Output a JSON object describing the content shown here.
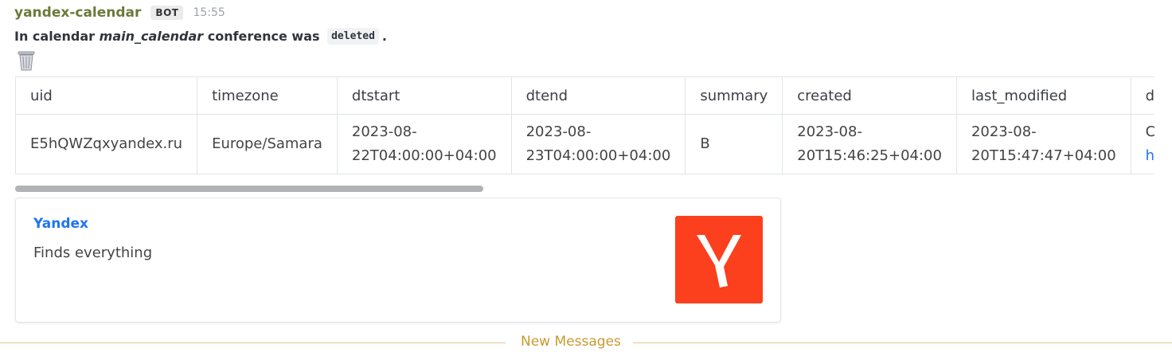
{
  "message": {
    "sender": "yandex-calendar",
    "badge": "BOT",
    "time": "15:55",
    "text_prefix": "In calendar ",
    "calendar_name": "main_calendar",
    "text_middle": " conference was ",
    "status_code": "deleted",
    "text_suffix": ".",
    "trash_icon": "wastebasket-icon"
  },
  "table": {
    "headers": [
      "uid",
      "timezone",
      "dtstart",
      "dtend",
      "summary",
      "created",
      "last_modified",
      "descrip"
    ],
    "row": {
      "uid": "E5hQWZqxyandex.ru",
      "timezone": "Europe/Samara",
      "dtstart_1": "2023-08-",
      "dtstart_2": "22T04:00:00+04:00",
      "dtend_1": "2023-08-",
      "dtend_2": "23T04:00:00+04:00",
      "summary": "B",
      "created_1": "2023-08-",
      "created_2": "20T15:46:25+04:00",
      "last_modified_1": "2023-08-",
      "last_modified_2": "20T15:47:47+04:00",
      "description_1": "Ссылка",
      "description_2": "https:/"
    }
  },
  "scrollbar": {
    "position": 0.0
  },
  "link_preview": {
    "title": "Yandex",
    "description": "Finds everything",
    "logo_icon": "yandex-logo",
    "logo_color": "#fc3f1d"
  },
  "divider": {
    "label": "New Messages",
    "color": "#c99a2e"
  }
}
